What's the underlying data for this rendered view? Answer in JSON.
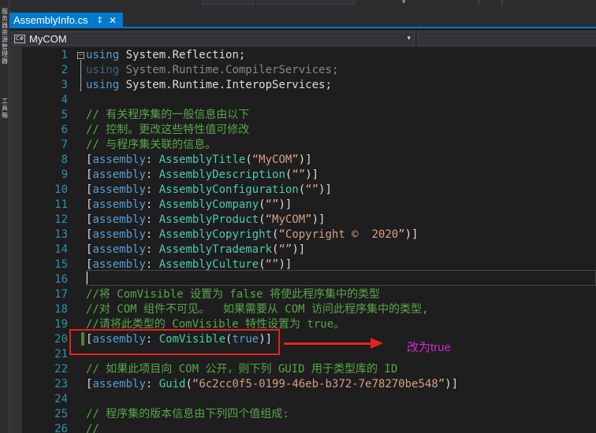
{
  "tab": {
    "title": "AssemblyInfo.cs",
    "pin_glyph": "↕",
    "close_glyph": "✕"
  },
  "navbar": {
    "icon_text": "C#",
    "project": "MyCOM",
    "chevron": "▾"
  },
  "left_strip": {
    "label_a": "服务器资源管理器",
    "label_b": "工具箱"
  },
  "annotation": {
    "note": "改为true",
    "color": "#e8221b",
    "note_color": "#d02ad0"
  },
  "line_numbers": [
    "1",
    "2",
    "3",
    "4",
    "5",
    "6",
    "7",
    "8",
    "9",
    "10",
    "11",
    "12",
    "13",
    "14",
    "15",
    "16",
    "17",
    "18",
    "19",
    "20",
    "21",
    "22",
    "23",
    "24",
    "25",
    "26"
  ],
  "code": {
    "l1": [
      "using",
      " System.Reflection;"
    ],
    "l2": [
      "using",
      " System.Runtime.CompilerServices;"
    ],
    "l3": [
      "using",
      " System.Runtime.InteropServices;"
    ],
    "l5": "// 有关程序集的一般信息由以下",
    "l6": "// 控制。更改这些特性值可修改",
    "l7": "// 与程序集关联的信息。",
    "l8": [
      "[",
      "assembly",
      ": ",
      "AssemblyTitle",
      "(",
      "“MyCOM”",
      ")]"
    ],
    "l9": [
      "[",
      "assembly",
      ": ",
      "AssemblyDescription",
      "(",
      "“”",
      ")]"
    ],
    "l10": [
      "[",
      "assembly",
      ": ",
      "AssemblyConfiguration",
      "(",
      "“”",
      ")]"
    ],
    "l11": [
      "[",
      "assembly",
      ": ",
      "AssemblyCompany",
      "(",
      "“”",
      ")]"
    ],
    "l12": [
      "[",
      "assembly",
      ": ",
      "AssemblyProduct",
      "(",
      "“MyCOM”",
      ")]"
    ],
    "l13": [
      "[",
      "assembly",
      ": ",
      "AssemblyCopyright",
      "(",
      "“Copyright ©  2020”",
      ")]"
    ],
    "l14": [
      "[",
      "assembly",
      ": ",
      "AssemblyTrademark",
      "(",
      "“”",
      ")]"
    ],
    "l15": [
      "[",
      "assembly",
      ": ",
      "AssemblyCulture",
      "(",
      "“”",
      ")]"
    ],
    "l17": "//将 ComVisible 设置为 false 将使此程序集中的类型",
    "l18": "//对 COM 组件不可见。  如果需要从 COM 访问此程序集中的类型,",
    "l19": "//请将此类型的 ComVisible 特性设置为 true。",
    "l20": [
      "[",
      "assembly",
      ": ",
      "ComVisible",
      "(",
      "true",
      ")]"
    ],
    "l22": "// 如果此项目向 COM 公开，则下列 GUID 用于类型库的 ID",
    "l23": [
      "[",
      "assembly",
      ": ",
      "Guid",
      "(",
      "“6c2cc0f5-0199-46eb-b372-7e78270be548”",
      ")]"
    ],
    "l25": "// 程序集的版本信息由下列四个值组成:",
    "l26": "//"
  }
}
